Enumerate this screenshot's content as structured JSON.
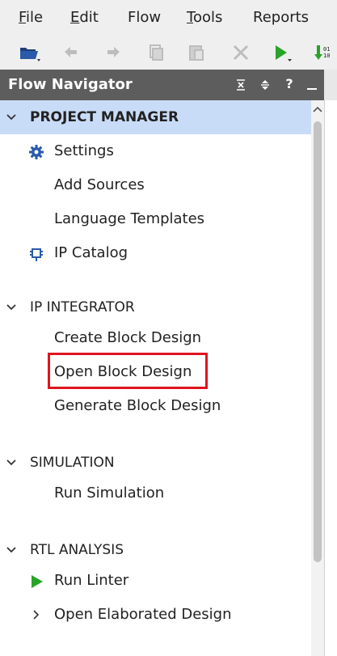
{
  "menubar": {
    "items": [
      {
        "label": "File"
      },
      {
        "label": "Edit"
      },
      {
        "label": "Flow"
      },
      {
        "label": "Tools"
      },
      {
        "label": "Reports"
      }
    ]
  },
  "toolbar": {
    "buttons": [
      {
        "icon": "open-folder-icon",
        "enabled": true
      },
      {
        "icon": "undo-icon",
        "enabled": false
      },
      {
        "icon": "redo-icon",
        "enabled": false
      },
      {
        "icon": "copy-icon",
        "enabled": false
      },
      {
        "icon": "paste-icon",
        "enabled": false
      },
      {
        "icon": "delete-icon",
        "enabled": false
      },
      {
        "icon": "run-icon",
        "enabled": true
      },
      {
        "icon": "program-device-icon",
        "enabled": true
      }
    ]
  },
  "panel": {
    "title": "Flow Navigator",
    "icons": [
      "collapse-all-icon",
      "expand-all-icon",
      "help-icon",
      "minimize-icon"
    ]
  },
  "tree": {
    "sections": [
      {
        "label": "PROJECT MANAGER",
        "expanded": true,
        "selected": true,
        "items": [
          {
            "label": "Settings",
            "icon": "gear-icon"
          },
          {
            "label": "Add Sources"
          },
          {
            "label": "Language Templates"
          },
          {
            "label": "IP Catalog",
            "icon": "ip-plug-icon"
          }
        ]
      },
      {
        "label": "IP INTEGRATOR",
        "expanded": true,
        "items": [
          {
            "label": "Create Block Design"
          },
          {
            "label": "Open Block Design",
            "highlighted": true
          },
          {
            "label": "Generate Block Design"
          }
        ]
      },
      {
        "label": "SIMULATION",
        "expanded": true,
        "items": [
          {
            "label": "Run Simulation"
          }
        ]
      },
      {
        "label": "RTL ANALYSIS",
        "expanded": true,
        "items": [
          {
            "label": "Run Linter",
            "icon": "play-icon"
          },
          {
            "label": "Open Elaborated Design",
            "expandable": true
          }
        ]
      }
    ]
  },
  "colors": {
    "menubar_bg": "#efefef",
    "panel_header_bg": "#5d5d5d",
    "selection_bg": "#c9dcf7",
    "highlight_border": "#e0141e",
    "run_green": "#29a329",
    "gear_blue": "#2a5aa8"
  }
}
